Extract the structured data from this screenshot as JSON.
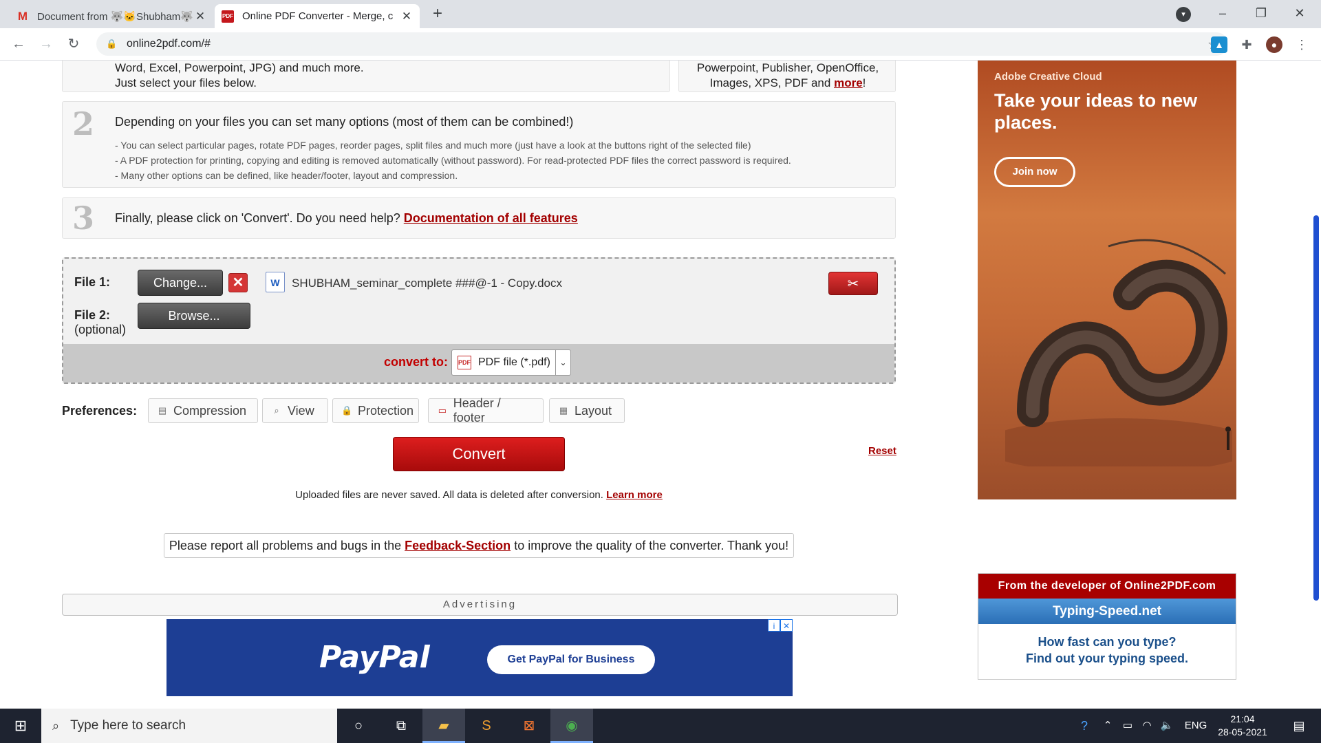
{
  "browser": {
    "tabs": [
      {
        "title": "Document from 🐺🐱Shubham🐺",
        "icon": "gmail-icon"
      },
      {
        "title": "Online PDF Converter - Merge, c",
        "icon": "pdf-icon"
      }
    ],
    "url": "online2pdf.com/#"
  },
  "steps": {
    "step1": {
      "line1": "Word, Excel, Powerpoint, JPG) and much more.",
      "line2": "Just select your files below.",
      "right_line1": "Powerpoint, Publisher, OpenOffice,",
      "right_line2": "Images, XPS, PDF and",
      "right_more": "more",
      "right_bang": "!"
    },
    "step2": {
      "number": "2",
      "heading": "Depending on your files you can set many options (most of them can be combined!)",
      "bullets": [
        "- You can select particular pages, rotate PDF pages, reorder pages, split files and much more (just have a look at the buttons right of the selected file)",
        "- A PDF protection for printing, copying and editing is removed automatically (without password). For read-protected PDF files the correct password is required.",
        "- Many other options can be defined, like header/footer, layout and compression."
      ]
    },
    "step3": {
      "number": "3",
      "text": "Finally, please click on 'Convert'. Do you need help?",
      "link": "Documentation of all features"
    }
  },
  "files": {
    "file1_label": "File 1:",
    "change_label": "Change...",
    "remove_label": "✕",
    "file1_name": "SHUBHAM_seminar_complete ###@-1 - Copy.docx",
    "file2_label": "File 2:",
    "file2_optional": "(optional)",
    "browse_label": "Browse...",
    "convert_to_label": "convert to:",
    "convert_to_value": "PDF file (*.pdf)"
  },
  "preferences": {
    "label": "Preferences:",
    "buttons": [
      "Compression",
      "View",
      "Protection",
      "Header / footer",
      "Layout"
    ]
  },
  "actions": {
    "convert": "Convert",
    "reset": "Reset"
  },
  "privacy": {
    "text": "Uploaded files are never saved. All data is deleted after conversion.",
    "link": "Learn more"
  },
  "feedback": {
    "pre": "Please report all problems and bugs in the",
    "link": "Feedback-Section",
    "post": "to improve the quality of the converter. Thank you!"
  },
  "advertising_label": "Advertising",
  "paypal_ad": {
    "logo": "PayPal",
    "cta": "Get PayPal for Business"
  },
  "adobe_ad": {
    "brand": "Adobe Creative Cloud",
    "headline": "Take your ideas to new places.",
    "cta": "Join now"
  },
  "developer_panel": {
    "heading": "From the developer of Online2PDF.com",
    "title": "Typing-Speed.net",
    "line1": "How fast can you type?",
    "line2": "Find out your typing speed."
  },
  "taskbar": {
    "search_placeholder": "Type here to search",
    "language": "ENG",
    "time": "21:04",
    "date": "28-05-2021"
  },
  "colors": {
    "accent_red": "#a30000",
    "convert_red": "#c20000",
    "paypal_blue": "#1d3e94"
  }
}
